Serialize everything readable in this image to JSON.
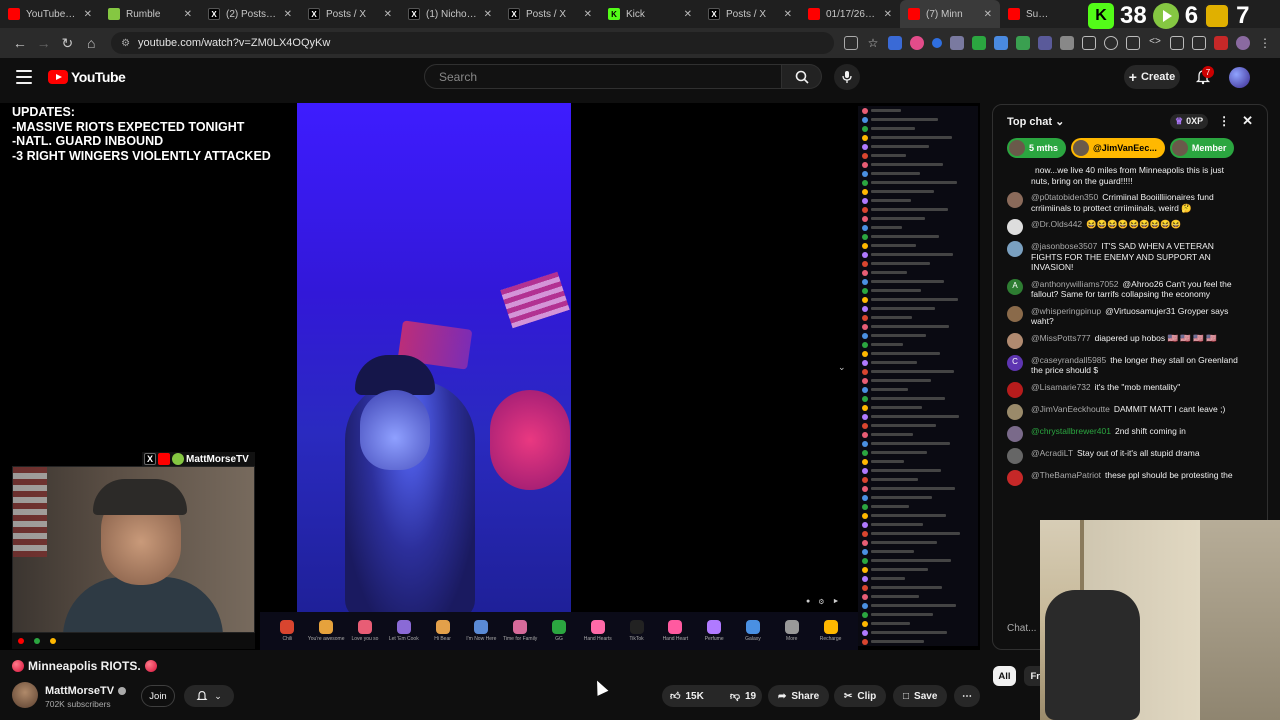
{
  "browser": {
    "tabs": [
      {
        "label": "YouTube Music",
        "icon": "youtube-music-icon",
        "color": "#ff0000"
      },
      {
        "label": "Rumble",
        "icon": "rumble-icon",
        "color": "#85c742"
      },
      {
        "label": "(2) Posts / X",
        "icon": "x-icon",
        "color": "#000000"
      },
      {
        "label": "Posts / X",
        "icon": "x-icon",
        "color": "#000000"
      },
      {
        "label": "(1) Nicholas J. F",
        "icon": "x-icon",
        "color": "#000000"
      },
      {
        "label": "Posts / X",
        "icon": "x-icon",
        "color": "#000000"
      },
      {
        "label": "Kick",
        "icon": "kick-icon",
        "color": "#53fc18"
      },
      {
        "label": "Posts / X",
        "icon": "x-icon",
        "color": "#000000"
      },
      {
        "label": "01/17/26 - ICE",
        "icon": "youtube-icon",
        "color": "#ff0000"
      },
      {
        "label": "(7) Minn",
        "icon": "youtube-icon",
        "color": "#ff0000",
        "active": true
      },
      {
        "label": "Subscripti",
        "icon": "youtube-icon",
        "color": "#ff0000"
      }
    ],
    "url": "youtube.com/watch?v=ZM0LX4OQyKw",
    "overlay": {
      "kick_count": "38",
      "rumble_count": "6",
      "other_count": "7"
    }
  },
  "youtube": {
    "logo_text": "YouTube",
    "search_placeholder": "Search",
    "create_label": "Create",
    "notification_count": "7"
  },
  "video": {
    "updates_banner": [
      "UPDATES:",
      "-MASSIVE RIOTS EXPECTED TONIGHT",
      "-NATL. GUARD INBOUND",
      "-3 RIGHT WINGERS VIOLENTLY ATTACKED"
    ],
    "cam_handle": "MattMorseTV",
    "gifts": [
      "Chili",
      "You're awesome",
      "Love you so",
      "Let 'Em Cook",
      "Hi Bear",
      "I'm Now Here",
      "Time for Family",
      "GG",
      "Hand Hearts",
      "TikTok",
      "Hand Heart",
      "Perfume",
      "Galaxy",
      "More",
      "Recharge"
    ]
  },
  "meta": {
    "title": "Minneapolis RIOTS.",
    "channel_name": "MattMorseTV",
    "subscribers": "702K subscribers",
    "join_label": "Join",
    "like_count": "15K",
    "dislike_count": "19",
    "share_label": "Share",
    "clip_label": "Clip",
    "save_label": "Save"
  },
  "chat": {
    "header": "Top chat",
    "xp": "0XP",
    "chips": [
      {
        "label": "5 mths",
        "color": "#2ba640"
      },
      {
        "label": "@JimVanEec...",
        "color": "#ffb800"
      },
      {
        "label": "Member",
        "color": "#2ba640"
      }
    ],
    "messages": [
      {
        "author": "",
        "text": "now...we live 40 miles from Minneapolis this is just nuts, bring on the guard!!!!!",
        "avatar": "#555555"
      },
      {
        "author": "@p0tatobiden350",
        "text": "Crrimiinal Booiilliionaires fund crriimiinals to prottect crriimiinals, weird 🤔",
        "avatar": "#8a6a5a"
      },
      {
        "author": "@Dr.Olds442",
        "text": "😆😆😆😆😆😆😆😆😆",
        "avatar": "#dddddd"
      },
      {
        "author": "@jasonbose3507",
        "text": "IT'S SAD WHEN A VETERAN FIGHTS FOR THE ENEMY AND SUPPORT AN INVASION!",
        "avatar": "#7aa0c0"
      },
      {
        "author": "@anthonywilliams7052",
        "text": "@Ahroo26 Can't you feel the fallout? Same for tarrifs collapsing the economy",
        "avatar": "#2e7d32",
        "initial": "A"
      },
      {
        "author": "@whisperingpinup",
        "text": "@Virtuosamujer31 Groyper says waht?",
        "avatar": "#8a6a4a"
      },
      {
        "author": "@MissPotts777",
        "text": "diapered up hobos 🇺🇸 🇺🇸 🇺🇸 🇺🇸",
        "avatar": "#b08a70"
      },
      {
        "author": "@caseyrandall5985",
        "text": "the longer they stall on Greenland the price should $",
        "avatar": "#5e35b1",
        "initial": "C"
      },
      {
        "author": "@Lisamarie732",
        "text": "it's the \"mob mentality\"",
        "avatar": "#b71c1c"
      },
      {
        "author": "@JimVanEeckhoutte",
        "text": "DAMMIT MATT I cant leave ;)",
        "avatar": "#9a8a6a"
      },
      {
        "author": "@chrystallbrewer401",
        "text": "2nd shift coming in",
        "avatar": "#7a6a8a",
        "green": true
      },
      {
        "author": "@AcradiLT",
        "text": "Stay out of it-it's all stupid drama",
        "avatar": "#666666"
      },
      {
        "author": "@TheBamaPatriot",
        "text": "these ppl should be protesting the",
        "avatar": "#c62828"
      }
    ],
    "input_placeholder": "Chat...",
    "filter_all": "All",
    "filter_friends": "Fr"
  }
}
